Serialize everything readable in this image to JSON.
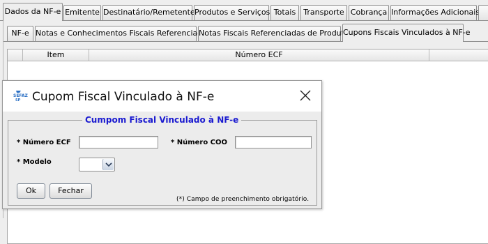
{
  "main_tabs": [
    {
      "label": "Dados da NF-e",
      "active": true
    },
    {
      "label": "Emitente",
      "active": false
    },
    {
      "label": "Destinatário/Remetente",
      "active": false
    },
    {
      "label": "Produtos e Serviços",
      "active": false
    },
    {
      "label": "Totais",
      "active": false
    },
    {
      "label": "Transporte",
      "active": false
    },
    {
      "label": "Cobrança",
      "active": false
    },
    {
      "label": "Informações Adicionais",
      "active": false
    }
  ],
  "sub_tabs": [
    {
      "label": "NF-e",
      "active": false
    },
    {
      "label": "Notas e Conhecimentos Fiscais Referenciados",
      "active": false
    },
    {
      "label": "Notas Fiscais Referenciadas de Produtor",
      "active": false
    },
    {
      "label": "Cupons Fiscais Vinculados à NF-e",
      "active": true
    }
  ],
  "table": {
    "columns": [
      "Item",
      "Número ECF"
    ],
    "rows": []
  },
  "dialog": {
    "title": "Cupom Fiscal Vinculado à NF-e",
    "logo_icon": "sefaz-logo-icon",
    "close_icon": "close-icon",
    "section_title": "Cumpom Fiscal Vinculado à NF-e",
    "fields": {
      "numero_ecf": {
        "label": "* Número ECF",
        "value": ""
      },
      "numero_coo": {
        "label": "* Número COO",
        "value": ""
      },
      "modelo": {
        "label": "* Modelo",
        "selected": ""
      }
    },
    "buttons": {
      "ok": "Ok",
      "fechar": "Fechar"
    },
    "footnote": "(*) Campo de preenchimento obrigatório."
  },
  "colors": {
    "section_title": "#1a1ad0",
    "dialog_body_bg": "#ececec",
    "window_bg": "#eeeeee"
  }
}
